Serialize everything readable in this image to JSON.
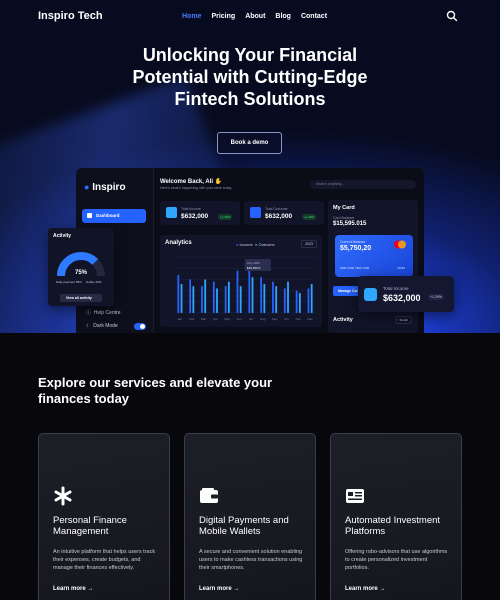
{
  "nav": {
    "brand": "Inspiro Tech",
    "links": [
      {
        "label": "Home",
        "active": true
      },
      {
        "label": "Pricing",
        "active": false
      },
      {
        "label": "About",
        "active": false
      },
      {
        "label": "Blog",
        "active": false
      },
      {
        "label": "Contact",
        "active": false
      }
    ]
  },
  "hero": {
    "title_lines": [
      "Unlocking Your Financial",
      "Potential with Cutting-Edge",
      "Fintech Solutions"
    ],
    "cta": "Book a demo"
  },
  "dashboard": {
    "logo": "Inspiro",
    "sidebar_active": "Dashboard",
    "help": "Help Centre",
    "dark_mode": "Dark Mode",
    "welcome": "Welcome Back, Ali",
    "welcome_sub": "Here's what's happening with your store today.",
    "search_placeholder": "Search anything...",
    "stats": [
      {
        "label": "Total Income",
        "value": "$632,000",
        "badge": "+1.29%",
        "color": "#2fa7ff"
      },
      {
        "label": "Total Outcome",
        "value": "$632,000",
        "badge": "+1.29%",
        "color": "#2463ff"
      }
    ],
    "analytics": {
      "title": "Analytics",
      "legend_income": "Income",
      "legend_outcome": "Outcome",
      "period": "2023",
      "tooltip_month": "July 2023",
      "tooltip_value": "$25,450.0",
      "months": [
        "Jan",
        "Feb",
        "Mar",
        "Apr",
        "May",
        "Jun",
        "Jul",
        "Aug",
        "Sep",
        "Oct",
        "Nov",
        "Dec"
      ],
      "income": [
        17,
        15,
        12,
        14,
        12,
        19,
        21,
        16,
        14,
        11,
        10,
        11
      ],
      "outcome": [
        13,
        12,
        15,
        11,
        14,
        12,
        16,
        13,
        12,
        14,
        9,
        13
      ]
    },
    "card": {
      "title": "My Card",
      "balance_label": "Card Balance",
      "balance": "$15,595.015",
      "current_balance_label": "Current Balance",
      "current_balance": "$5,750,20",
      "number": "5282 3456 7890 1289",
      "expiry": "09/25",
      "manage": "Manage Cards"
    },
    "activity_title": "Activity",
    "activity_period": "Month"
  },
  "widgets": {
    "activity": {
      "title": "Activity",
      "percent": "75%",
      "percent_value": 75,
      "s1": "Daily payment 55%",
      "s2": "Hobby 20%",
      "button": "View all activity"
    },
    "income": {
      "label": "Total Income",
      "value": "$632,000",
      "badge": "+1.29%"
    }
  },
  "services": {
    "heading": "Explore our services and elevate your finances today",
    "cards": [
      {
        "icon": "asterisk-icon",
        "title": "Personal Finance Management",
        "desc": "An intuitive platform that helps users track their expenses, create budgets, and manage their finances effectively.",
        "more": "Learn more"
      },
      {
        "icon": "wallet-icon",
        "title": "Digital Payments and Mobile Wallets",
        "desc": "A secure and convenient solution enabling users to make cashless transactions using their smartphones.",
        "more": "Learn more"
      },
      {
        "icon": "id-card-icon",
        "title": "Automated Investment Platforms",
        "desc": "Offering robo-advisors that use algorithms to create personalized investment portfolios.",
        "more": "Learn more"
      }
    ]
  },
  "colors": {
    "accent": "#2463ff",
    "nav_active": "#4a7bff"
  }
}
